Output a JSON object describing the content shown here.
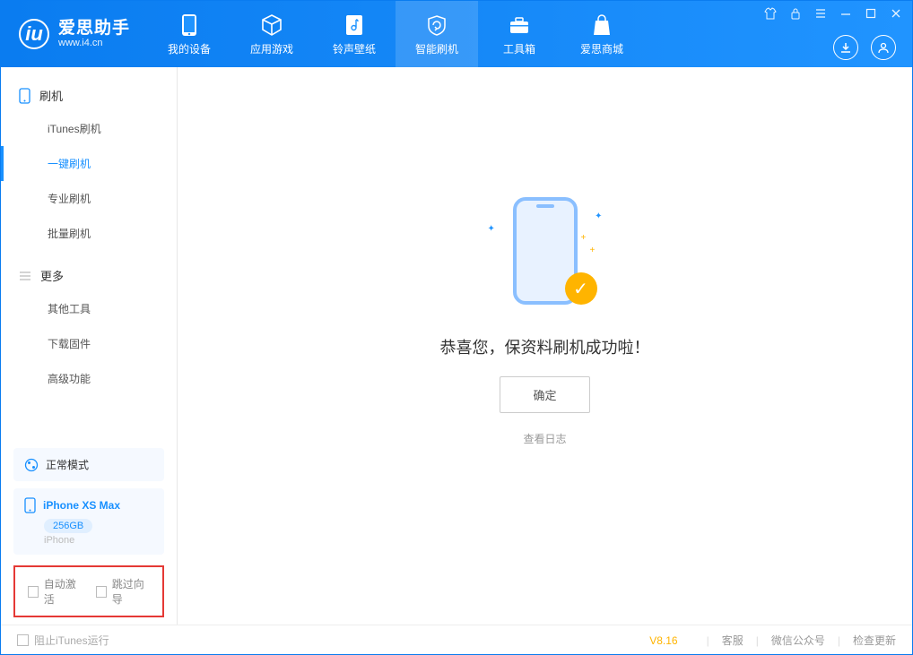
{
  "app": {
    "title": "爱思助手",
    "subtitle": "www.i4.cn"
  },
  "nav": {
    "mydevice": "我的设备",
    "apps": "应用游戏",
    "ringtone": "铃声壁纸",
    "flash": "智能刷机",
    "toolbox": "工具箱",
    "store": "爱思商城"
  },
  "sidebar": {
    "group1": "刷机",
    "items1": {
      "itunes": "iTunes刷机",
      "onekey": "一键刷机",
      "pro": "专业刷机",
      "batch": "批量刷机"
    },
    "group2": "更多",
    "items2": {
      "other": "其他工具",
      "firmware": "下载固件",
      "advanced": "高级功能"
    },
    "mode": "正常模式",
    "device": {
      "name": "iPhone XS Max",
      "capacity": "256GB",
      "type": "iPhone"
    },
    "opts": {
      "autoactivate": "自动激活",
      "skipguide": "跳过向导"
    }
  },
  "main": {
    "success": "恭喜您，保资料刷机成功啦！",
    "ok": "确定",
    "viewlog": "查看日志"
  },
  "footer": {
    "blockitunes": "阻止iTunes运行",
    "version": "V8.16",
    "kefu": "客服",
    "wechat": "微信公众号",
    "update": "检查更新"
  }
}
